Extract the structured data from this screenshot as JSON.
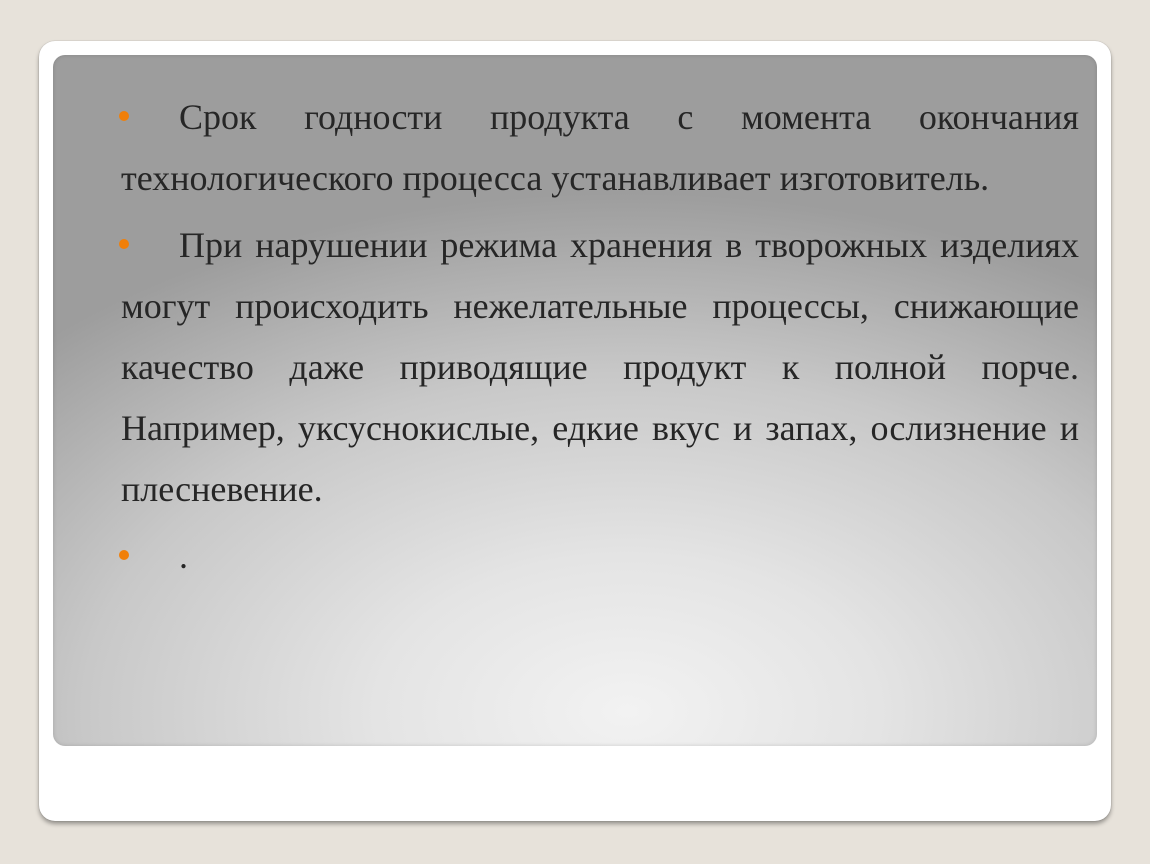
{
  "slide": {
    "bullets": [
      {
        "text": "Срок годности продукта с момента окончания технологического процесса устанавливает изготовитель."
      },
      {
        "text": "При нарушении режима хранения в творожных изделиях могут происходить нежелательные процессы, снижающие качество даже приводящие продукт к полной порче. Например, уксуснокислые, едкие вкус и запах, ослизнение и плесневение."
      },
      {
        "text": "."
      }
    ],
    "colors": {
      "bullet": "#f07f09",
      "text": "#262626",
      "background": "#e7e2da"
    },
    "icons": {
      "bullet": "orange-bullet-dot-icon"
    }
  }
}
